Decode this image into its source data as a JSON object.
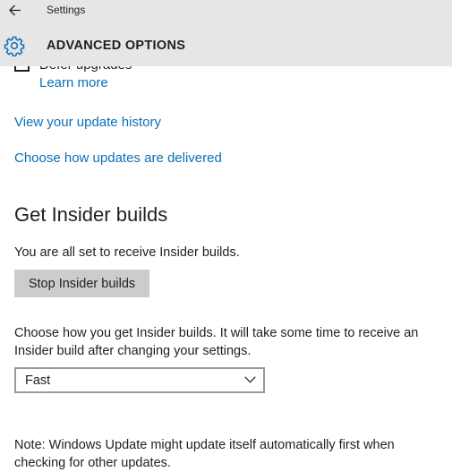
{
  "window": {
    "title": "Settings"
  },
  "header": {
    "page_title": "ADVANCED OPTIONS",
    "icon": "gear-icon",
    "back_icon": "back-arrow-icon"
  },
  "defer": {
    "label": "Defer upgrades",
    "checked": false,
    "learn_more": "Learn more"
  },
  "links": {
    "history": "View your update history",
    "delivery": "Choose how updates are delivered"
  },
  "insider": {
    "heading": "Get Insider builds",
    "status": "You are all set to receive Insider builds.",
    "stop_button": "Stop Insider builds",
    "description": "Choose how you get Insider builds. It will take some time to receive an Insider build after changing your settings.",
    "ring_selected": "Fast"
  },
  "note": "Note: Windows Update might update itself automatically first when checking for other updates.",
  "colors": {
    "header_bg": "#e6e6e6",
    "link": "#0b6fb8",
    "button_bg": "#cccccc"
  }
}
